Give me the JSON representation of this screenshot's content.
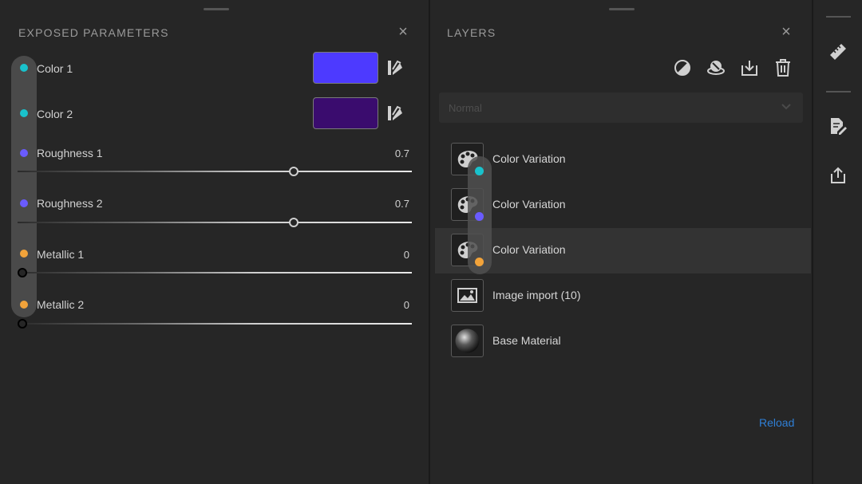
{
  "colors": {
    "cyan": "#19c2cc",
    "purple": "#6a5bff",
    "orange": "#f2a33a",
    "color1": "#4d3aff",
    "color2": "#3a0c6e",
    "link": "#2f7fd6"
  },
  "exposed_parameters": {
    "title": "EXPOSED PARAMETERS",
    "close_icon": "close-icon",
    "params": [
      {
        "label": "Color 1",
        "type": "color",
        "dot": "cyan",
        "swatch": "#4d3aff"
      },
      {
        "label": "Color 2",
        "type": "color",
        "dot": "cyan",
        "swatch": "#3a0c6e"
      },
      {
        "label": "Roughness 1",
        "type": "slider",
        "dot": "purple",
        "value": "0.7",
        "fraction": 0.7
      },
      {
        "label": "Roughness 2",
        "type": "slider",
        "dot": "purple",
        "value": "0.7",
        "fraction": 0.7
      },
      {
        "label": "Metallic 1",
        "type": "slider",
        "dot": "orange",
        "value": "0",
        "fraction": 0
      },
      {
        "label": "Metallic 2",
        "type": "slider",
        "dot": "orange",
        "value": "0",
        "fraction": 0
      }
    ]
  },
  "layers": {
    "title": "LAYERS",
    "toolbar": [
      "mask-icon",
      "fill-layer-icon",
      "import-icon",
      "trash-icon"
    ],
    "blend_mode": "Normal",
    "items": [
      {
        "name": "Color Variation",
        "icon": "palette-icon",
        "badge": "cyan",
        "selected": false
      },
      {
        "name": "Color Variation",
        "icon": "palette-icon",
        "badge": "purple",
        "selected": false
      },
      {
        "name": "Color Variation",
        "icon": "palette-icon",
        "badge": "orange",
        "selected": true
      },
      {
        "name": "Image import (10)",
        "icon": "image-icon",
        "badge": null,
        "selected": false
      },
      {
        "name": "Base Material",
        "icon": "sphere-icon",
        "badge": null,
        "selected": false
      }
    ],
    "reload": "Reload"
  },
  "rail": {
    "icons": [
      "ruler-icon",
      "edit-document-icon",
      "share-icon"
    ]
  }
}
